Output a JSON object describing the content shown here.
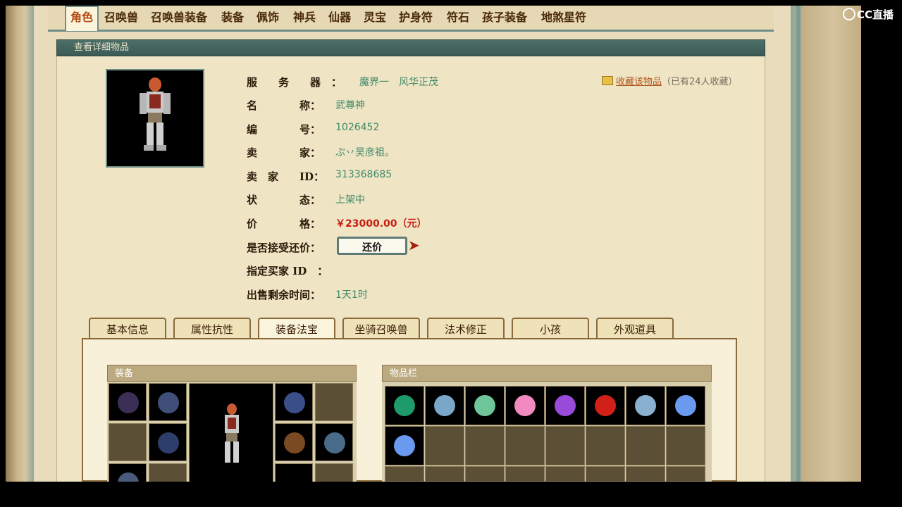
{
  "top_tabs": [
    {
      "label": "角色",
      "active": true
    },
    {
      "label": "召唤兽"
    },
    {
      "label": "召唤兽装备"
    },
    {
      "label": "装备"
    },
    {
      "label": "佩饰"
    },
    {
      "label": "神兵"
    },
    {
      "label": "仙器"
    },
    {
      "label": "灵宝"
    },
    {
      "label": "护身符"
    },
    {
      "label": "符石"
    },
    {
      "label": "孩子装备"
    },
    {
      "label": "地煞星符"
    }
  ],
  "header_strip": "查看详细物品",
  "watermark": "CC直播",
  "details": [
    {
      "label": "服　　务　　器　：",
      "value": "魔界一　风华正茂"
    },
    {
      "label": "名　　　　称：",
      "value": "武尊神"
    },
    {
      "label": "编　　　　号：",
      "value": "1026452"
    },
    {
      "label": "卖　　　　家：",
      "value": "ぷ丷吴彦祖。"
    },
    {
      "label": "卖　家　　ID：",
      "value": "313368685"
    },
    {
      "label": "状　　　　态：",
      "value": "上架中"
    },
    {
      "label": "价　　　　格：",
      "value": "￥23000.00（元）"
    },
    {
      "label": "是否接受还价：",
      "value": ""
    },
    {
      "label": "指定买家 ID　：",
      "value": ""
    },
    {
      "label": "出售剩余时间：",
      "value": "1天1时"
    }
  ],
  "bargain_button": "还价",
  "favorite": {
    "link": "收藏该物品",
    "count_text": "（已有24人收藏）"
  },
  "sub_tabs": [
    {
      "label": "基本信息"
    },
    {
      "label": "属性抗性"
    },
    {
      "label": "装备法宝",
      "active": true
    },
    {
      "label": "坐骑召唤兽"
    },
    {
      "label": "法术修正"
    },
    {
      "label": "小孩"
    },
    {
      "label": "外观道具"
    }
  ],
  "equipment_title": "装备",
  "inventory_title": "物品栏",
  "inventory_icons": [
    "green-orb",
    "ice-crystal",
    "jade-tablet",
    "pink-heart",
    "purple-crystal",
    "red-gem",
    "ice-cube",
    "blue-crystal",
    "blue-crystal"
  ],
  "colors": {
    "accent": "#6f8f86",
    "price": "#c81e12",
    "value": "#3f8a6a"
  }
}
